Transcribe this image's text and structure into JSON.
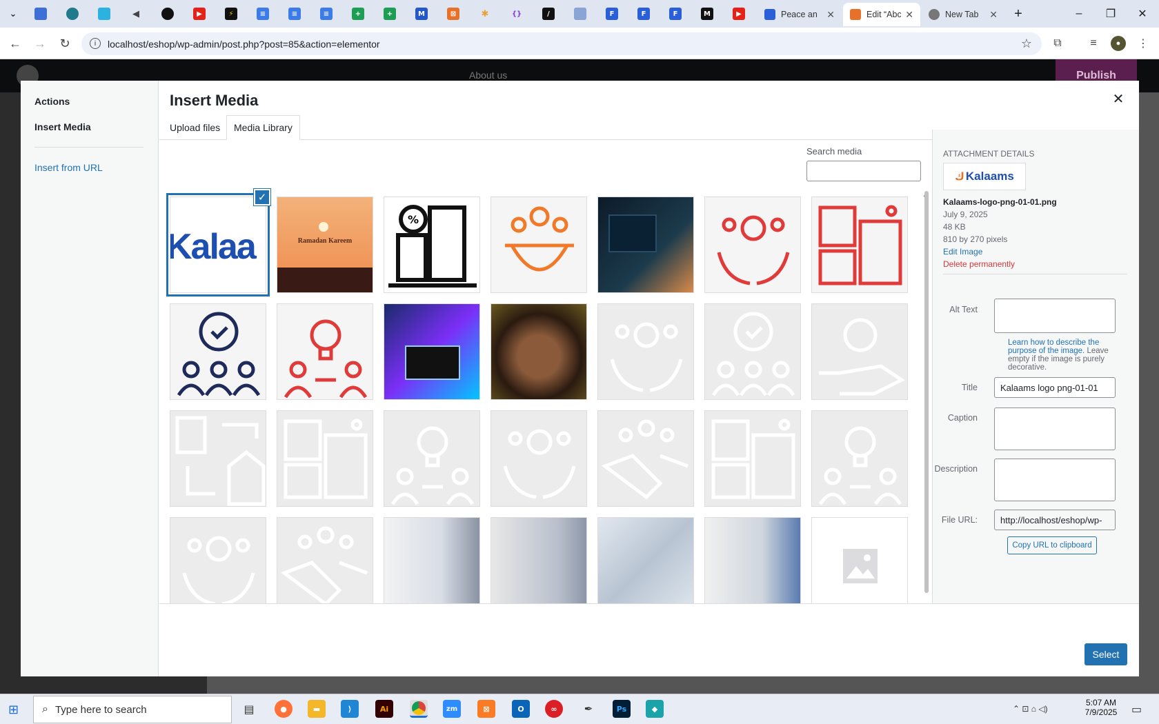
{
  "browser": {
    "tabs": [
      {
        "title": "Peace an",
        "color": "#2b5fd9"
      },
      {
        "title": "Edit “Abc",
        "color": "#e8712a"
      },
      {
        "title": "New Tab",
        "color": "#777"
      }
    ],
    "url": "localhost/eshop/wp-admin/post.php?post=85&action=elementor",
    "new_tab_symbol": "+"
  },
  "editor": {
    "page_selector": "About us",
    "publish_label": "Publish"
  },
  "modal": {
    "title": "Insert Media",
    "sidebar": {
      "actions_heading": "Actions",
      "insert_media": "Insert Media",
      "insert_from_url": "Insert from URL"
    },
    "tabs": [
      "Upload files",
      "Media Library"
    ],
    "search_label": "Search media",
    "search_value": "",
    "attachment": {
      "heading": "ATTACHMENT DETAILS",
      "thumb_text": "Kalaams",
      "filename": "Kalaams-logo-png-01-01.png",
      "date": "July 9, 2025",
      "size": "48 KB",
      "dimensions": "810 by 270 pixels",
      "edit_link": "Edit Image",
      "delete_link": "Delete permanently",
      "alt_label": "Alt Text",
      "alt_value": "",
      "alt_help": "Learn how to describe the purpose of the image.",
      "alt_help_suffix": " Leave empty if the image is purely decorative.",
      "title_label": "Title",
      "title_value": "Kalaams logo png-01-01",
      "caption_label": "Caption",
      "description_label": "Description",
      "file_url_label": "File URL:",
      "file_url_value": "http://localhost/eshop/wp-",
      "copy_button": "Copy URL to clipboard"
    },
    "select_button": "Select",
    "grid": [
      {
        "kind": "kalaam-logo",
        "text": "Kalaa",
        "selected": true
      },
      {
        "kind": "ramadan",
        "text": "Ramadan Kareem"
      },
      {
        "kind": "building-icon"
      },
      {
        "kind": "team-gear-icon"
      },
      {
        "kind": "coder-photo"
      },
      {
        "kind": "hands-gear-icon"
      },
      {
        "kind": "puzzle-icon"
      },
      {
        "kind": "award-team-icon"
      },
      {
        "kind": "idea-transfer-icon"
      },
      {
        "kind": "robot-laptop-photo"
      },
      {
        "kind": "woman-photo"
      },
      {
        "kind": "placeholder-hands"
      },
      {
        "kind": "placeholder-award"
      },
      {
        "kind": "placeholder-hand-gear"
      },
      {
        "kind": "placeholder-building"
      },
      {
        "kind": "placeholder-puzzle"
      },
      {
        "kind": "placeholder-idea"
      },
      {
        "kind": "placeholder-hands-gear"
      },
      {
        "kind": "placeholder-handshake"
      },
      {
        "kind": "placeholder-puzzle"
      },
      {
        "kind": "placeholder-idea"
      },
      {
        "kind": "placeholder-hands-gear"
      },
      {
        "kind": "placeholder-handshake"
      },
      {
        "kind": "faded-hand-photo"
      },
      {
        "kind": "faded-dark-photo"
      },
      {
        "kind": "faded-tech-photo"
      },
      {
        "kind": "faded-network-photo"
      },
      {
        "kind": "image-placeholder"
      }
    ]
  },
  "taskbar": {
    "search_placeholder": "Type here to search",
    "time": "5:07 AM",
    "date": "7/9/2025"
  }
}
